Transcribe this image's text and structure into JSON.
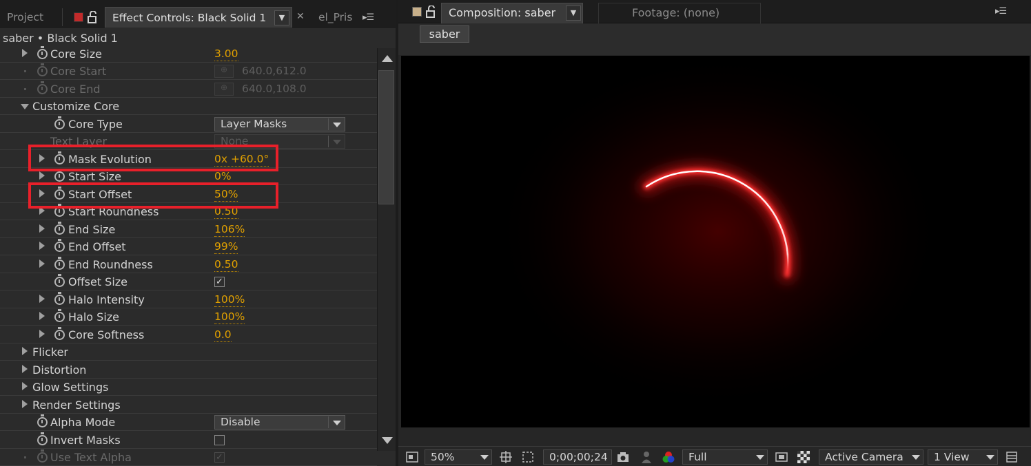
{
  "left_tabs": {
    "project": "Project",
    "effect_controls": "Effect Controls: Black Solid 1",
    "prism": "el_Pris"
  },
  "layer_title": "saber • Black Solid 1",
  "rows": [
    {
      "label": "Core Size",
      "value": "3.00"
    },
    {
      "label": "Core Start",
      "value": "640.0,612.0"
    },
    {
      "label": "Core End",
      "value": "640.0,108.0"
    },
    {
      "label": "Customize Core"
    },
    {
      "label": "Core Type",
      "value": "Layer Masks"
    },
    {
      "label": "Text Layer",
      "value": "None"
    },
    {
      "label": "Mask Evolution",
      "value": "0x +60.0°"
    },
    {
      "label": "Start Size",
      "value": "0%"
    },
    {
      "label": "Start Offset",
      "value": "50%"
    },
    {
      "label": "Start Roundness",
      "value": "0.50"
    },
    {
      "label": "End Size",
      "value": "106%"
    },
    {
      "label": "End Offset",
      "value": "99%"
    },
    {
      "label": "End Roundness",
      "value": "0.50"
    },
    {
      "label": "Offset Size",
      "value": "✓"
    },
    {
      "label": "Halo Intensity",
      "value": "100%"
    },
    {
      "label": "Halo Size",
      "value": "100%"
    },
    {
      "label": "Core Softness",
      "value": "0.0"
    },
    {
      "label": "Flicker"
    },
    {
      "label": "Distortion"
    },
    {
      "label": "Glow Settings"
    },
    {
      "label": "Render Settings"
    },
    {
      "label": "Alpha Mode",
      "value": "Disable"
    },
    {
      "label": "Invert Masks",
      "value": ""
    },
    {
      "label": "Use Text Alpha",
      "value": "✓"
    }
  ],
  "right": {
    "comp_tab": "Composition: saber",
    "footage_tab": "Footage: (none)",
    "breadcrumb": "saber",
    "zoom": "50%",
    "timecode": "0;00;00;24",
    "resolution": "Full",
    "camera": "Active Camera",
    "views": "1 View"
  },
  "colors": {
    "accent_value": "#e0a000",
    "highlight": "#e8202a",
    "saber_glow": "#ff1a1a"
  },
  "icons": [
    "stopwatch-icon",
    "lock-icon",
    "panel-menu-icon",
    "camera-icon",
    "color-channels-icon",
    "checkerboard-icon"
  ]
}
